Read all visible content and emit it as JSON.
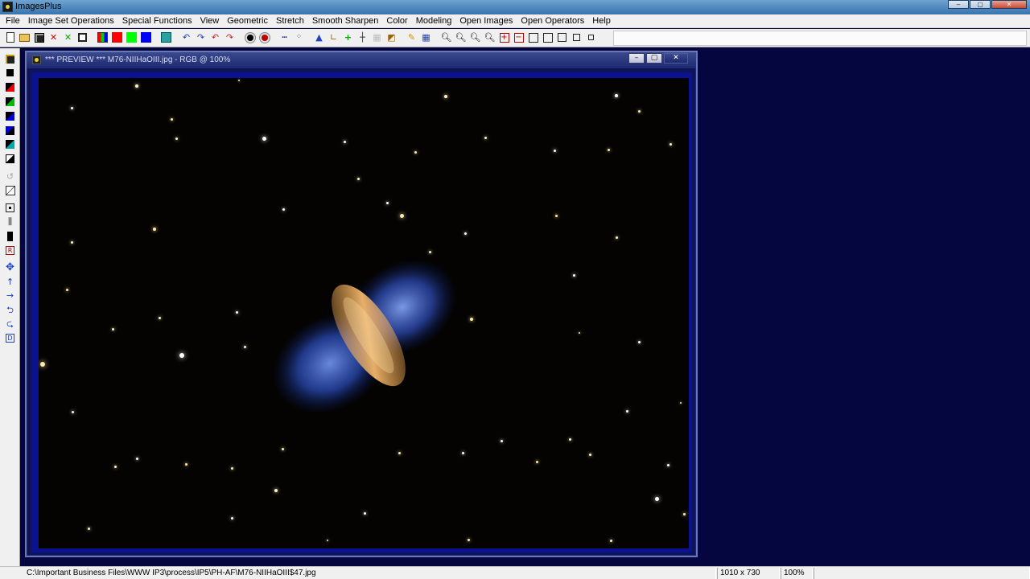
{
  "app": {
    "title": "ImagesPlus",
    "window_buttons": [
      "–",
      "▢",
      "✕"
    ]
  },
  "menu": [
    "File",
    "Image Set Operations",
    "Special Functions",
    "View",
    "Geometric",
    "Stretch",
    "Smooth Sharpen",
    "Color",
    "Modeling",
    "Open Images",
    "Open Operators",
    "Help"
  ],
  "toolbar": {
    "icons": [
      "new-file-icon",
      "open-folder-icon",
      "save-icon",
      "close-red-x-icon",
      "close-green-x-icon",
      "copy-icon",
      "rgb-channels-icon",
      "red-channel-icon",
      "green-channel-icon",
      "blue-channel-icon",
      "grid-icon",
      "undo-icon",
      "redo-icon",
      "undo-red-icon",
      "redo-red-icon",
      "dot-black-icon",
      "dot-red-icon",
      "dashes-icon",
      "points-icon",
      "histogram-icon",
      "axes-icon",
      "crosshair-icon",
      "plus-icon",
      "frame-icon",
      "adjust-icon",
      "pencil-icon",
      "table-icon",
      "zoom-in-icon",
      "zoom-out-icon",
      "zoom-fit-icon",
      "zoom-actual-icon",
      "zoom-plus-icon",
      "zoom-minus-icon",
      "box-1-icon",
      "box-2-icon",
      "box-3-icon",
      "box-4-icon",
      "box-5-icon"
    ],
    "colors": {
      "red": "#ff0000",
      "green": "#00ff00",
      "blue": "#0000ff"
    }
  },
  "left_toolbar": [
    "save-icon",
    "black-square-icon",
    "red-black-icon",
    "green-black-icon",
    "blue-black-icon",
    "blue-black-2-icon",
    "black-teal-icon",
    "black-white-icon",
    "rotate-icon",
    "diagonal-icon",
    "center-box-icon",
    "gradient-icon",
    "black-bar-icon",
    "select-icon",
    "move-icon",
    "arrow-up-icon",
    "arrow-right-icon",
    "rotate-left-icon",
    "rotate-right-icon",
    "book-icon"
  ],
  "image_window": {
    "title": "*** PREVIEW *** M76-NIIHaOIII.jpg - RGB @ 100%",
    "buttons": [
      "–",
      "▢",
      "✕"
    ]
  },
  "status": {
    "path": "C:\\Important Business Files\\WWW IP3\\process\\IP5\\PH-AF\\M76-NIIHaOIII$47.jpg",
    "dimensions": "1010 x 730",
    "zoom": "100%"
  }
}
